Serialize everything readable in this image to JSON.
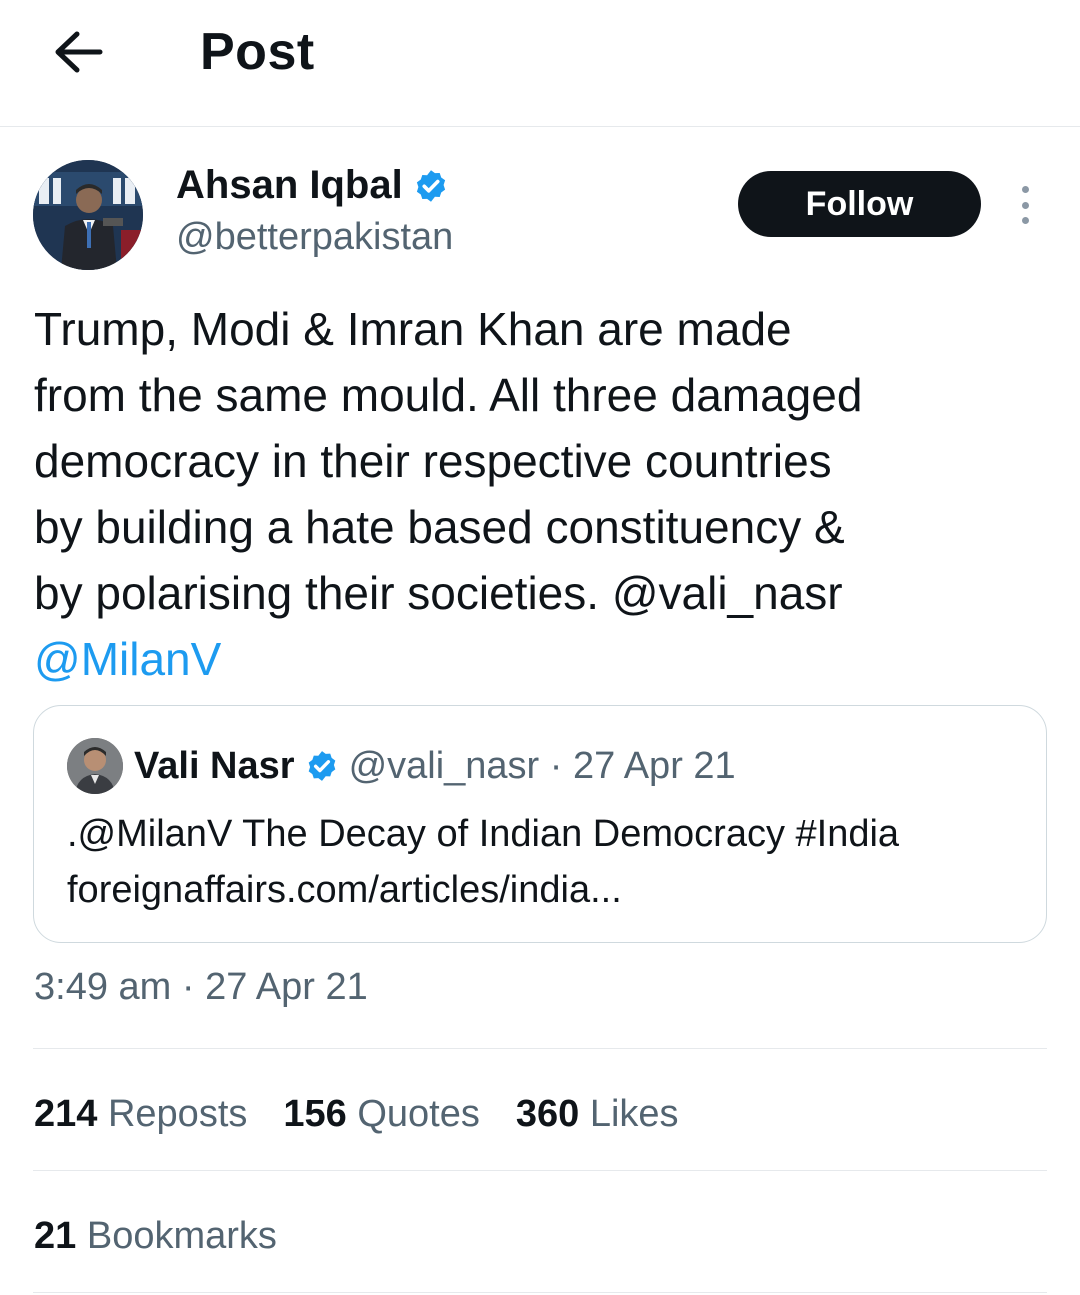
{
  "header": {
    "title": "Post",
    "back_icon": "arrow-left-icon"
  },
  "author": {
    "name": "Ahsan Iqbal",
    "handle": "@betterpakistan",
    "verified": true,
    "verified_color": "#1d9bf0"
  },
  "follow_label": "Follow",
  "tweet": {
    "lines": [
      "Trump, Modi & Imran Khan are made",
      "from the same mould. All three damaged",
      "democracy in their respective countries",
      "by building a hate based constituency &",
      "by polarising their societies. @vali_nasr"
    ],
    "mention": "@MilanV"
  },
  "quoted": {
    "name": "Vali Nasr",
    "meta": "@vali_nasr · 27 Apr 21",
    "lines": [
      ".@MilanV The Decay of Indian Democracy #India",
      "foreignaffairs.com/articles/india..."
    ]
  },
  "timestamp": "3:49 am · 27 Apr 21",
  "stats": {
    "reposts": {
      "count": "214",
      "label": "Reposts"
    },
    "quotes": {
      "count": "156",
      "label": "Quotes"
    },
    "likes": {
      "count": "360",
      "label": "Likes"
    },
    "bookmarks": {
      "count": "21",
      "label": "Bookmarks"
    }
  },
  "colors": {
    "accent": "#1d9bf0",
    "text": "#0f1419",
    "secondary": "#536471",
    "border": "#cfd9de"
  }
}
